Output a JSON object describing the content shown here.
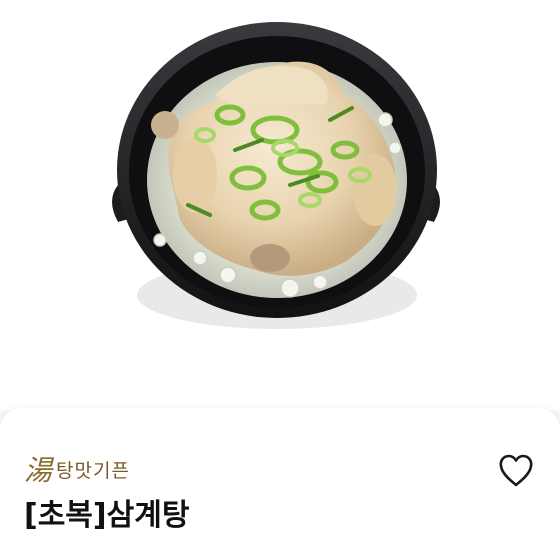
{
  "product": {
    "brand_logo_text": "湯",
    "brand_name": "탕맛기픈",
    "title": "[초복]삼계탕"
  },
  "icons": {
    "wishlist": "heart-outline-icon"
  },
  "colors": {
    "brand": "#7a5a28",
    "title": "#111111",
    "card_background": "#ffffff",
    "page_background": "#f7f7f7"
  }
}
